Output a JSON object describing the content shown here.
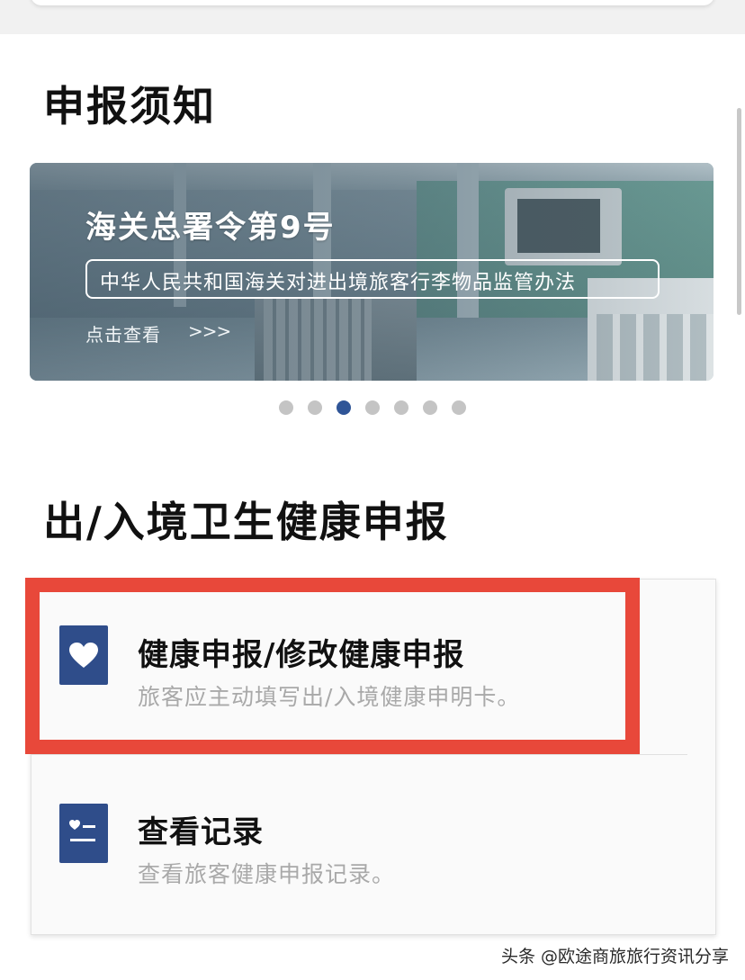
{
  "notice_section": {
    "title": "申报须知"
  },
  "banner": {
    "heading": "海关总署令第9号",
    "subtitle": "中华人民共和国海关对进出境旅客行李物品监管办法",
    "link_text": "点击查看",
    "link_arrows": ">>>"
  },
  "carousel": {
    "total_slides": 7,
    "active_index": 3,
    "active_color": "#2f5597",
    "inactive_color": "#c4c4c4"
  },
  "health_section": {
    "title": "出/入境卫生健康申报",
    "items": [
      {
        "icon": "heart-icon",
        "title": "健康申报/修改健康申报",
        "description": "旅客应主动填写出/入境健康申明卡。",
        "highlighted": true
      },
      {
        "icon": "records-icon",
        "title": "查看记录",
        "description": "查看旅客健康申报记录。",
        "highlighted": false
      }
    ]
  },
  "highlight_color": "#e8483a",
  "icon_color": "#2f4d8a",
  "watermark": "头条 @欧途商旅旅行资讯分享"
}
